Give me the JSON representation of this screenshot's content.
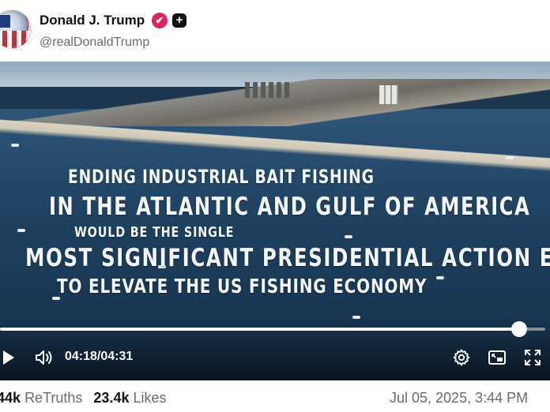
{
  "post": {
    "author_name": "Donald J. Trump",
    "verified_mark": "✔",
    "plus_badge": "+",
    "handle": "@realDonaldTrump"
  },
  "video": {
    "overlay_lines": [
      "ENDING INDUSTRIAL BAIT FISHING",
      "IN THE ATLANTIC AND GULF OF AMERICA",
      "WOULD BE THE SINGLE",
      "MOST SIGNIFICANT PRESIDENTIAL ACTION EVER",
      "TO ELEVATE THE US FISHING ECONOMY"
    ],
    "current_time": "04:18",
    "separator": "/",
    "total_time": "04:31",
    "progress_fraction": 0.952,
    "icons": [
      "play-icon",
      "volume-icon",
      "gear-icon",
      "picture-in-picture-icon",
      "fullscreen-icon"
    ]
  },
  "stats": {
    "retruths_count": "44k",
    "retruths_label": "ReTruths",
    "likes_count": "23.4k",
    "likes_label": "Likes",
    "timestamp": "Jul 05, 2025, 3:44 PM"
  },
  "colors": {
    "verified": "#e0245e",
    "text_primary": "#111111",
    "text_secondary": "#6b6b6b"
  }
}
